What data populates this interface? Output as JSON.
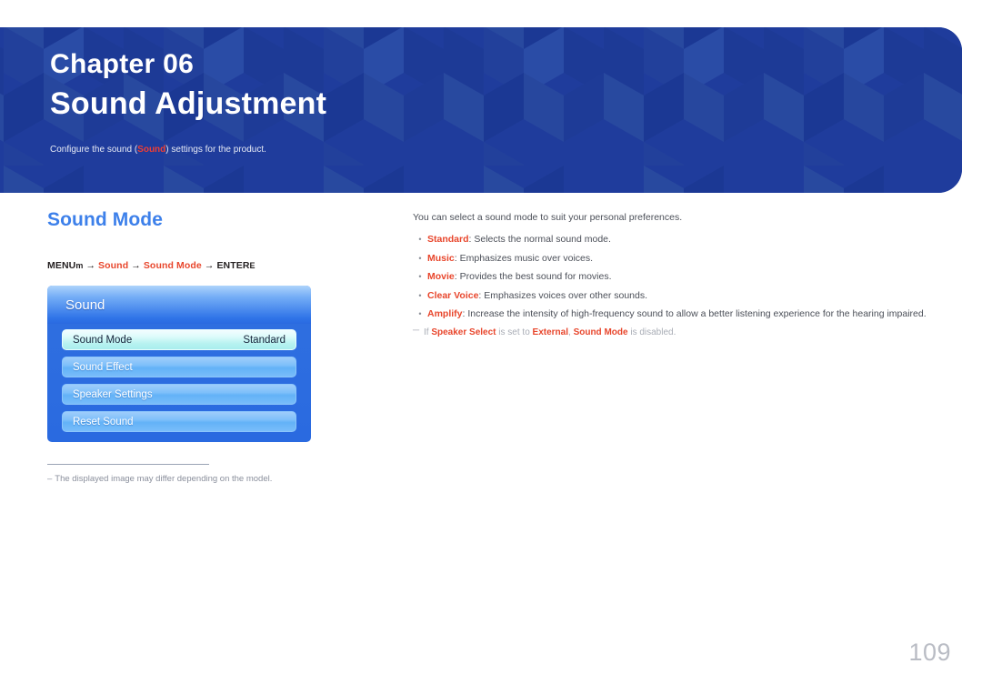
{
  "banner": {
    "chapter_label": "Chapter 06",
    "chapter_title": "Sound Adjustment",
    "description_prefix": "Configure the sound (",
    "description_highlight": "Sound",
    "description_suffix": ") settings for the product.",
    "background_color": "#1f3c9c",
    "highlight_color": "#ef3e33"
  },
  "section": {
    "heading": "Sound Mode",
    "heading_color": "#3d80ea",
    "menu_path": {
      "start_label": "MENU",
      "start_glyph": "m",
      "arrow": "→",
      "step1": "Sound",
      "step2": "Sound Mode",
      "end_label": "ENTER",
      "end_glyph": "E",
      "accent_color": "#e8462c"
    }
  },
  "osd": {
    "title": "Sound",
    "rows": [
      {
        "label": "Sound Mode",
        "value": "Standard",
        "selected": true
      },
      {
        "label": "Sound Effect",
        "value": "",
        "selected": false
      },
      {
        "label": "Speaker Settings",
        "value": "",
        "selected": false
      },
      {
        "label": "Reset Sound",
        "value": "",
        "selected": false
      }
    ]
  },
  "image_note": {
    "dash": "–",
    "text": "The displayed image may differ depending on the model."
  },
  "description": {
    "lead": "You can select a sound mode to suit your personal preferences.",
    "bullet_marker": "•",
    "items": [
      {
        "term": "Standard",
        "text": ": Selects the normal sound mode."
      },
      {
        "term": "Music",
        "text": ": Emphasizes music over voices."
      },
      {
        "term": "Movie",
        "text": ": Provides the best sound for movies."
      },
      {
        "term": "Clear Voice",
        "text": ": Emphasizes voices over other sounds."
      },
      {
        "term": "Amplify",
        "text": ": Increase the intensity of high-frequency sound to allow a better listening experience for the hearing impaired."
      }
    ],
    "footnote": {
      "dash": "─",
      "part1": "If ",
      "term1": "Speaker Select",
      "part2": " is set to ",
      "term2": "External",
      "part3": ", ",
      "term3": "Sound Mode",
      "part4": " is disabled."
    }
  },
  "page_number": "109"
}
